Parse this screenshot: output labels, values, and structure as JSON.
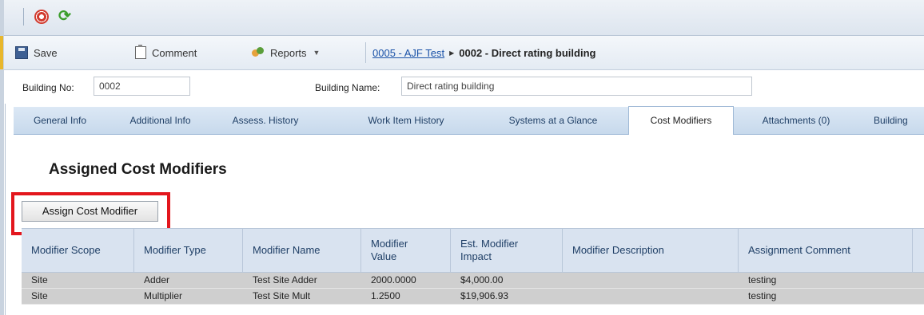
{
  "toolbar": {
    "save_label": "Save",
    "comment_label": "Comment",
    "reports_label": "Reports",
    "breadcrumb_link": "0005 - AJF Test",
    "breadcrumb_current": "0002 - Direct rating building"
  },
  "fields": {
    "building_no_label": "Building No:",
    "building_no_value": "0002",
    "building_name_label": "Building Name:",
    "building_name_value": "Direct rating building"
  },
  "tabs": [
    {
      "label": "General Info"
    },
    {
      "label": "Additional Info"
    },
    {
      "label": "Assess. History"
    },
    {
      "label": "Work Item History"
    },
    {
      "label": "Systems at a Glance"
    },
    {
      "label": "Cost Modifiers"
    },
    {
      "label": "Attachments (0)"
    },
    {
      "label": "Building"
    }
  ],
  "active_tab": "Cost Modifiers",
  "section": {
    "title": "Assigned Cost Modifiers",
    "assign_button": "Assign Cost Modifier"
  },
  "grid": {
    "columns": [
      "Modifier Scope",
      "Modifier Type",
      "Modifier Name",
      "Modifier Value",
      "Est. Modifier Impact",
      "Modifier Description",
      "Assignment Comment"
    ],
    "rows": [
      [
        "Site",
        "Adder",
        "Test Site Adder",
        "2000.0000",
        "$4,000.00",
        "",
        "testing"
      ],
      [
        "Site",
        "Multiplier",
        "Test Site Mult",
        "1.2500",
        "$19,906.93",
        "",
        "testing"
      ]
    ]
  },
  "colors": {
    "highlight": "#e3161d",
    "tab_bar": "#c7d9ec",
    "header_bg": "#d9e3f0",
    "row_bg": "#cfcfcf"
  }
}
